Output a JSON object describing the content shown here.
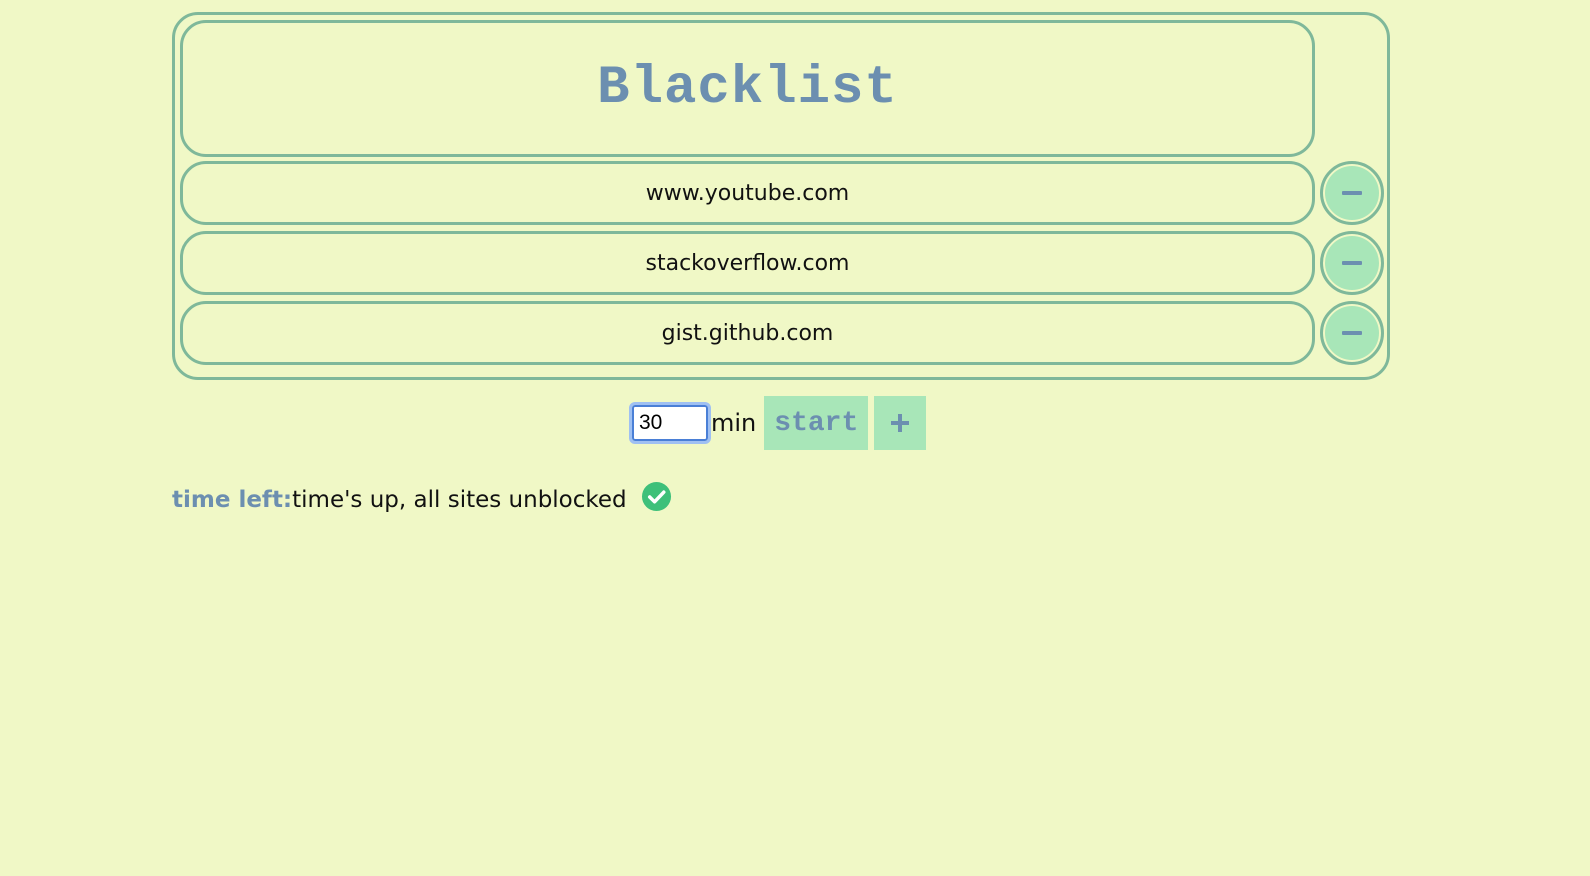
{
  "header": {
    "title": "Blacklist"
  },
  "blacklist": {
    "sites": [
      {
        "url": "www.youtube.com",
        "remove_icon": "minus-icon"
      },
      {
        "url": "stackoverflow.com",
        "remove_icon": "minus-icon"
      },
      {
        "url": "gist.github.com",
        "remove_icon": "minus-icon"
      }
    ]
  },
  "controls": {
    "minutes_value": "30",
    "unit_label": "min",
    "start_label": "start",
    "add_icon": "plus-icon"
  },
  "status": {
    "label": "time left:",
    "value": "time's up, all sites unblocked",
    "icon": "check-circle-icon"
  },
  "colors": {
    "background": "#f0f8c6",
    "border": "#7fb89a",
    "button_fill": "#a8e6b8",
    "accent_text": "#6c8fb0",
    "success": "#3ec07a",
    "input_focus": "#4a7fd6"
  }
}
